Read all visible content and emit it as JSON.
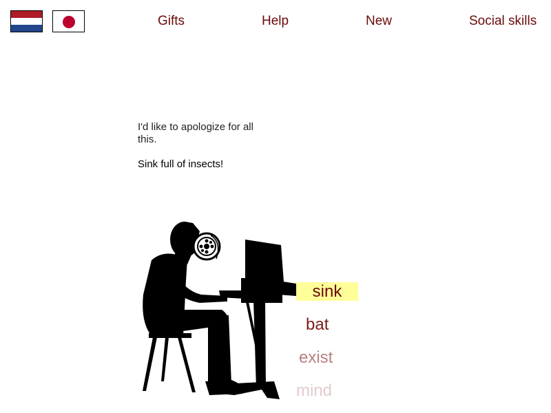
{
  "language_flags": [
    {
      "name": "Dutch",
      "colors": [
        "#ae1c28",
        "#ffffff",
        "#21468b"
      ]
    },
    {
      "name": "Japanese",
      "colors": [
        "#ffffff",
        "#bc002d"
      ]
    }
  ],
  "nav": {
    "gifts": "Gifts",
    "help": "Help",
    "new": "New",
    "social_skills": "Social skills"
  },
  "message": {
    "line1": "I'd like to apologize for all this.",
    "line2": "Sink full of insects!"
  },
  "illustration": {
    "icon": "person-at-computer-with-drain-head"
  },
  "words": [
    {
      "label": "sink",
      "highlighted": true
    },
    {
      "label": "bat"
    },
    {
      "label": "exist"
    },
    {
      "label": "mind"
    }
  ],
  "colors": {
    "link": "#6b0a0a",
    "highlight": "#ffff99"
  }
}
